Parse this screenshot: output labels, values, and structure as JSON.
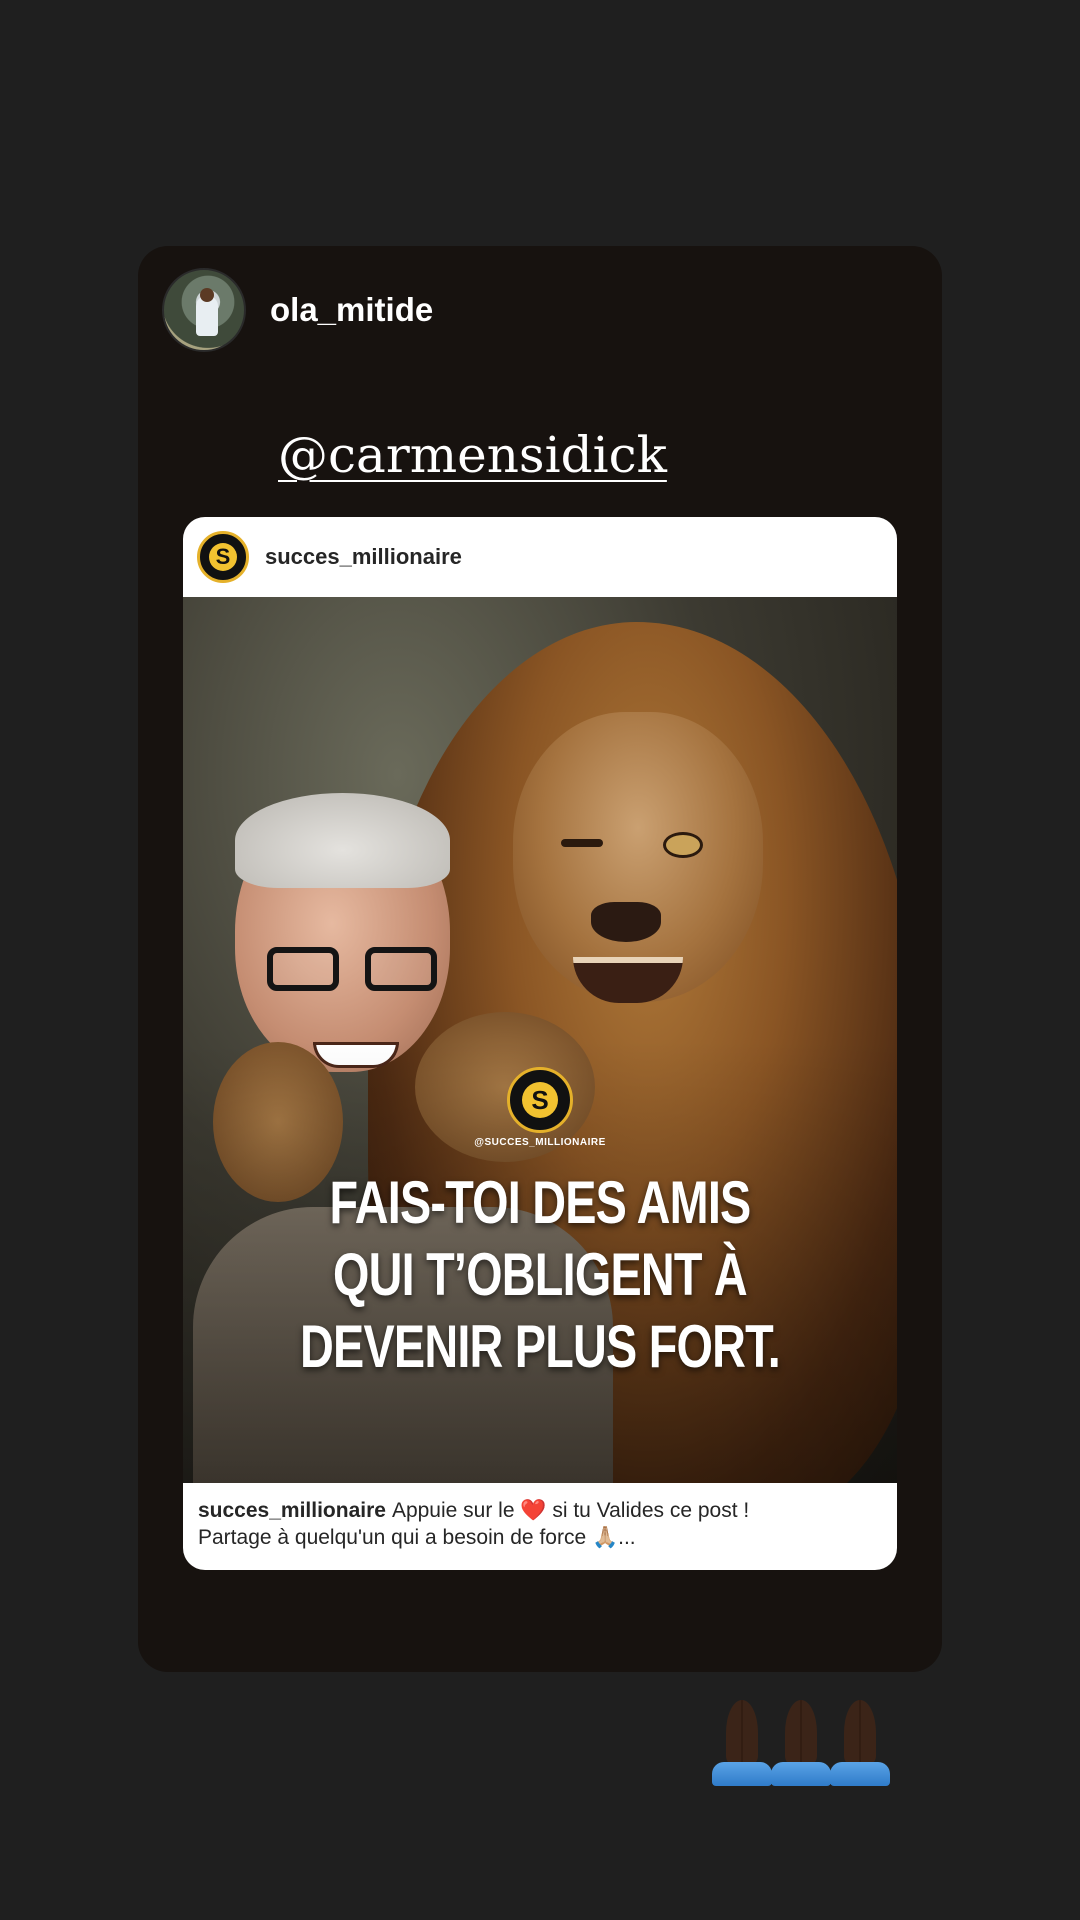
{
  "story": {
    "username": "ola_mitide",
    "mention": "@carmensidick"
  },
  "post": {
    "username": "succes_millionaire",
    "logo_letter": "S",
    "watermark_handle": "@SUCCES_MILLIONAIRE",
    "quote_lines": [
      "FAIS-TOI DES AMIS",
      "QUI T’OBLIGENT À",
      "DEVENIR PLUS FORT."
    ],
    "caption_user": "succes_millionaire",
    "caption_line1": "Appuie sur le ❤️ si tu Valides ce post !",
    "caption_line2": "Partage à quelqu'un qui a besoin de force 🙏🏼..."
  },
  "sticker": {
    "emoji": "🙏🏿🙏🏿🙏🏿",
    "icon": "praying-hands-icon",
    "count": 3
  },
  "colors": {
    "background": "#1f1f1f",
    "card": "#17120f",
    "logo_gold": "#e5b12a"
  }
}
